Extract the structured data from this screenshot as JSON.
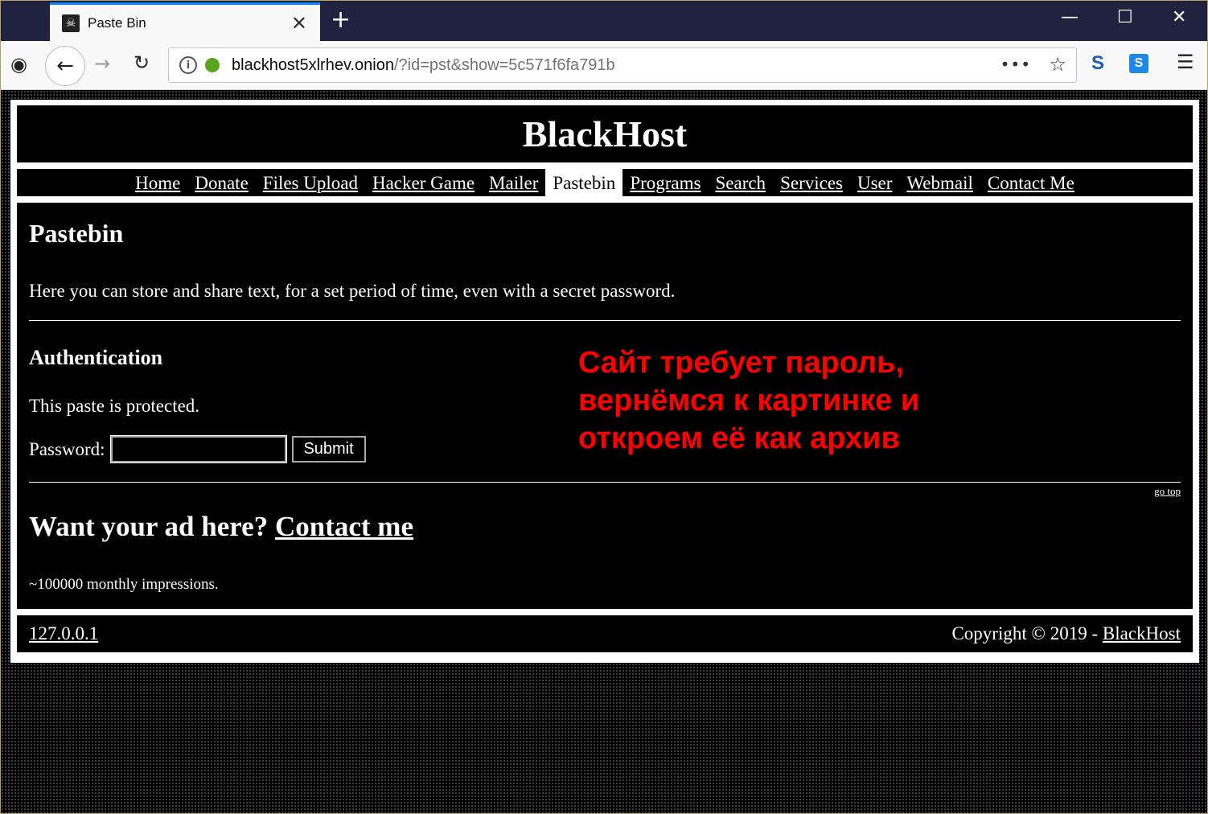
{
  "browser": {
    "tab_title": "Paste Bin",
    "tab_close": "✕",
    "new_tab": "+",
    "minimize": "—",
    "maximize": "☐",
    "close": "✕",
    "back": "←",
    "forward": "→",
    "reload": "↻",
    "url_host": "blackhost5xlrhev.onion",
    "url_path": "/?id=pst&show=5c571f6fa791b",
    "page_actions": "•••",
    "bookmark": "☆",
    "ext_s": "S",
    "ext_skype": "S",
    "menu": "☰"
  },
  "site": {
    "title": "BlackHost",
    "nav": [
      "Home",
      "Donate",
      "Files Upload",
      "Hacker Game",
      "Mailer",
      "Pastebin",
      "Programs",
      "Search",
      "Services",
      "User",
      "Webmail",
      "Contact Me"
    ],
    "active_nav": "Pastebin"
  },
  "main": {
    "heading": "Pastebin",
    "intro": "Here you can store and share text, for a set period of time, even with a secret password.",
    "auth_heading": "Authentication",
    "protected_text": "This paste is protected.",
    "password_label": "Password:",
    "password_value": "",
    "submit_label": "Submit",
    "overlay_note": "Сайт требует пароль, вернёмся к картинке и откроем её как архив",
    "go_top": "go top",
    "ad_text": "Want your ad here?",
    "ad_link": "Contact me",
    "impressions": "~100000 monthly impressions."
  },
  "footer": {
    "ip": "127.0.0.1",
    "copyright": "Copyright © 2019 -",
    "brand_link": "BlackHost"
  },
  "colors": {
    "accent_tab": "#0a84ff",
    "tabbar_bg": "#202340",
    "overlay_text": "#ff0000"
  }
}
